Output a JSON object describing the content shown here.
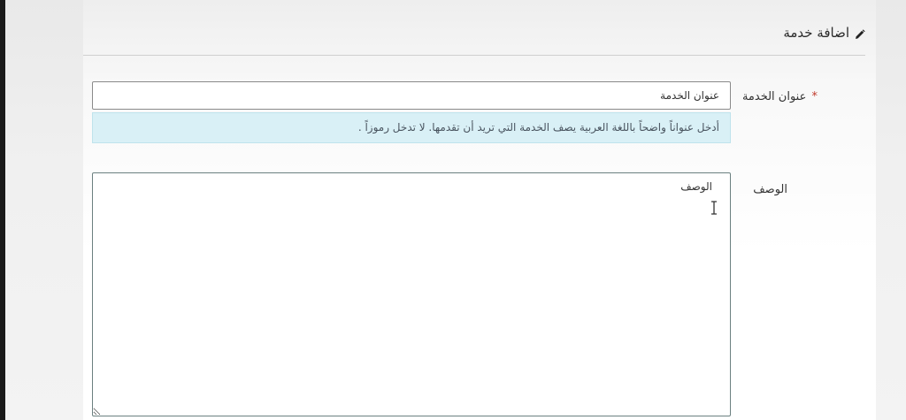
{
  "header": {
    "title": "اضافة خدمة",
    "icon": "pencil-icon"
  },
  "form": {
    "service_title": {
      "label": "عنوان الخدمة",
      "required_mark": "*",
      "value": "عنوان الخدمة",
      "hint": "أدخل عنواناً واضحاً باللغة العربية يصف الخدمة التي تريد أن تقدمها. لا تدخل رموزاً ."
    },
    "description": {
      "label": "الوصف",
      "value": "الوصف"
    }
  },
  "colors": {
    "hint_background": "#d9f0f6",
    "required": "#c0392b"
  }
}
